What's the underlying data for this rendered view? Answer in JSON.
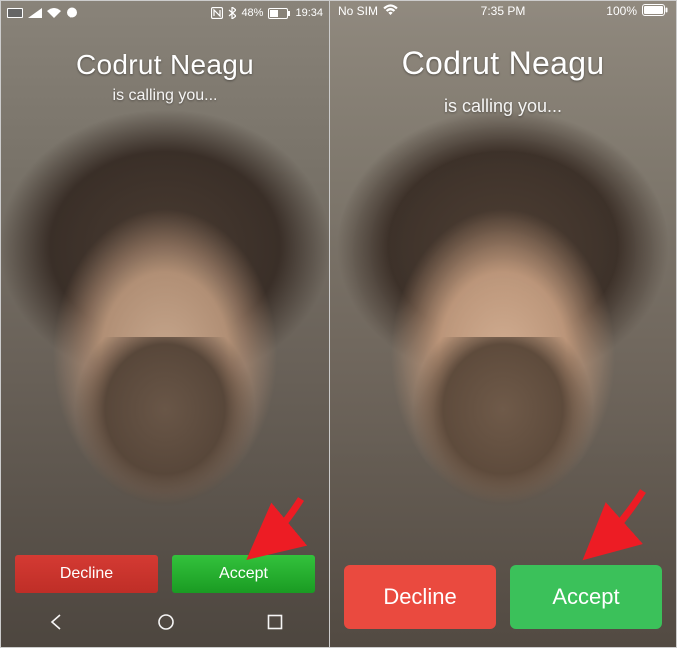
{
  "left": {
    "status": {
      "battery_text": "48%",
      "time": "19:34"
    },
    "caller_name": "Codrut Neagu",
    "subtitle": "is calling you...",
    "decline_label": "Decline",
    "accept_label": "Accept"
  },
  "right": {
    "status": {
      "carrier": "No SIM",
      "time": "7:35 PM",
      "battery_text": "100%"
    },
    "caller_name": "Codrut Neagu",
    "subtitle": "is calling you...",
    "decline_label": "Decline",
    "accept_label": "Accept"
  },
  "colors": {
    "decline": "#d93a32",
    "accept": "#2db74f",
    "arrow": "#ed1c24"
  }
}
